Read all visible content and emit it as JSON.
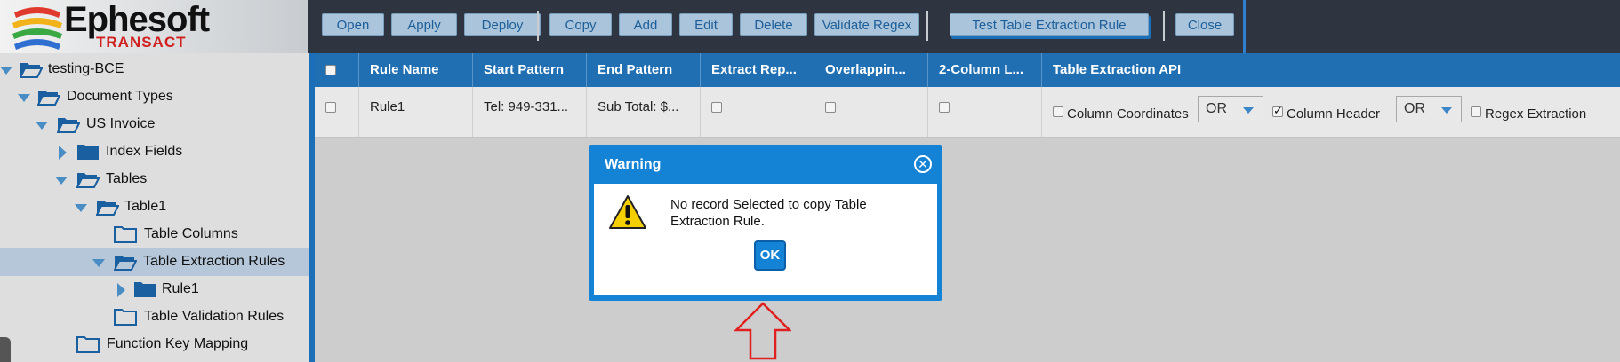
{
  "brand": {
    "title": "Ephesoft",
    "subtitle": "TRANSACT"
  },
  "toolbar": {
    "buttons": [
      "Open",
      "Apply",
      "Deploy",
      "Copy",
      "Add",
      "Edit",
      "Delete",
      "Validate Regex",
      "Test Table Extraction Rule",
      "Close"
    ]
  },
  "tree": {
    "items": [
      {
        "label": "testing-BCE"
      },
      {
        "label": "Document Types"
      },
      {
        "label": "US Invoice"
      },
      {
        "label": "Index Fields"
      },
      {
        "label": "Tables"
      },
      {
        "label": "Table1"
      },
      {
        "label": "Table Columns"
      },
      {
        "label": "Table Extraction Rules",
        "selected": true
      },
      {
        "label": "Rule1"
      },
      {
        "label": "Table Validation Rules"
      },
      {
        "label": "Function Key Mapping"
      }
    ]
  },
  "grid": {
    "columns": [
      "Rule Name",
      "Start Pattern",
      "End Pattern",
      "Extract Rep...",
      "Overlappin...",
      "2-Column L...",
      "Table Extraction API"
    ],
    "rows": [
      {
        "rule_name": "Rule1",
        "start_pattern": "Tel: 949-331...",
        "end_pattern": "Sub Total: $...",
        "column_coordinates_label": "Column Coordinates",
        "op1": "OR",
        "column_header_label": "Column Header",
        "op2": "OR",
        "regex_extraction_label": "Regex Extraction",
        "column_header_checked": true
      }
    ]
  },
  "dialog": {
    "title": "Warning",
    "message": "No record Selected to copy Table Extraction Rule.",
    "ok_label": "OK"
  },
  "colors": {
    "accent": "#1483d6",
    "header": "#1f6fb2",
    "toolbar": "#2e3440",
    "arrow": "#e02020"
  }
}
